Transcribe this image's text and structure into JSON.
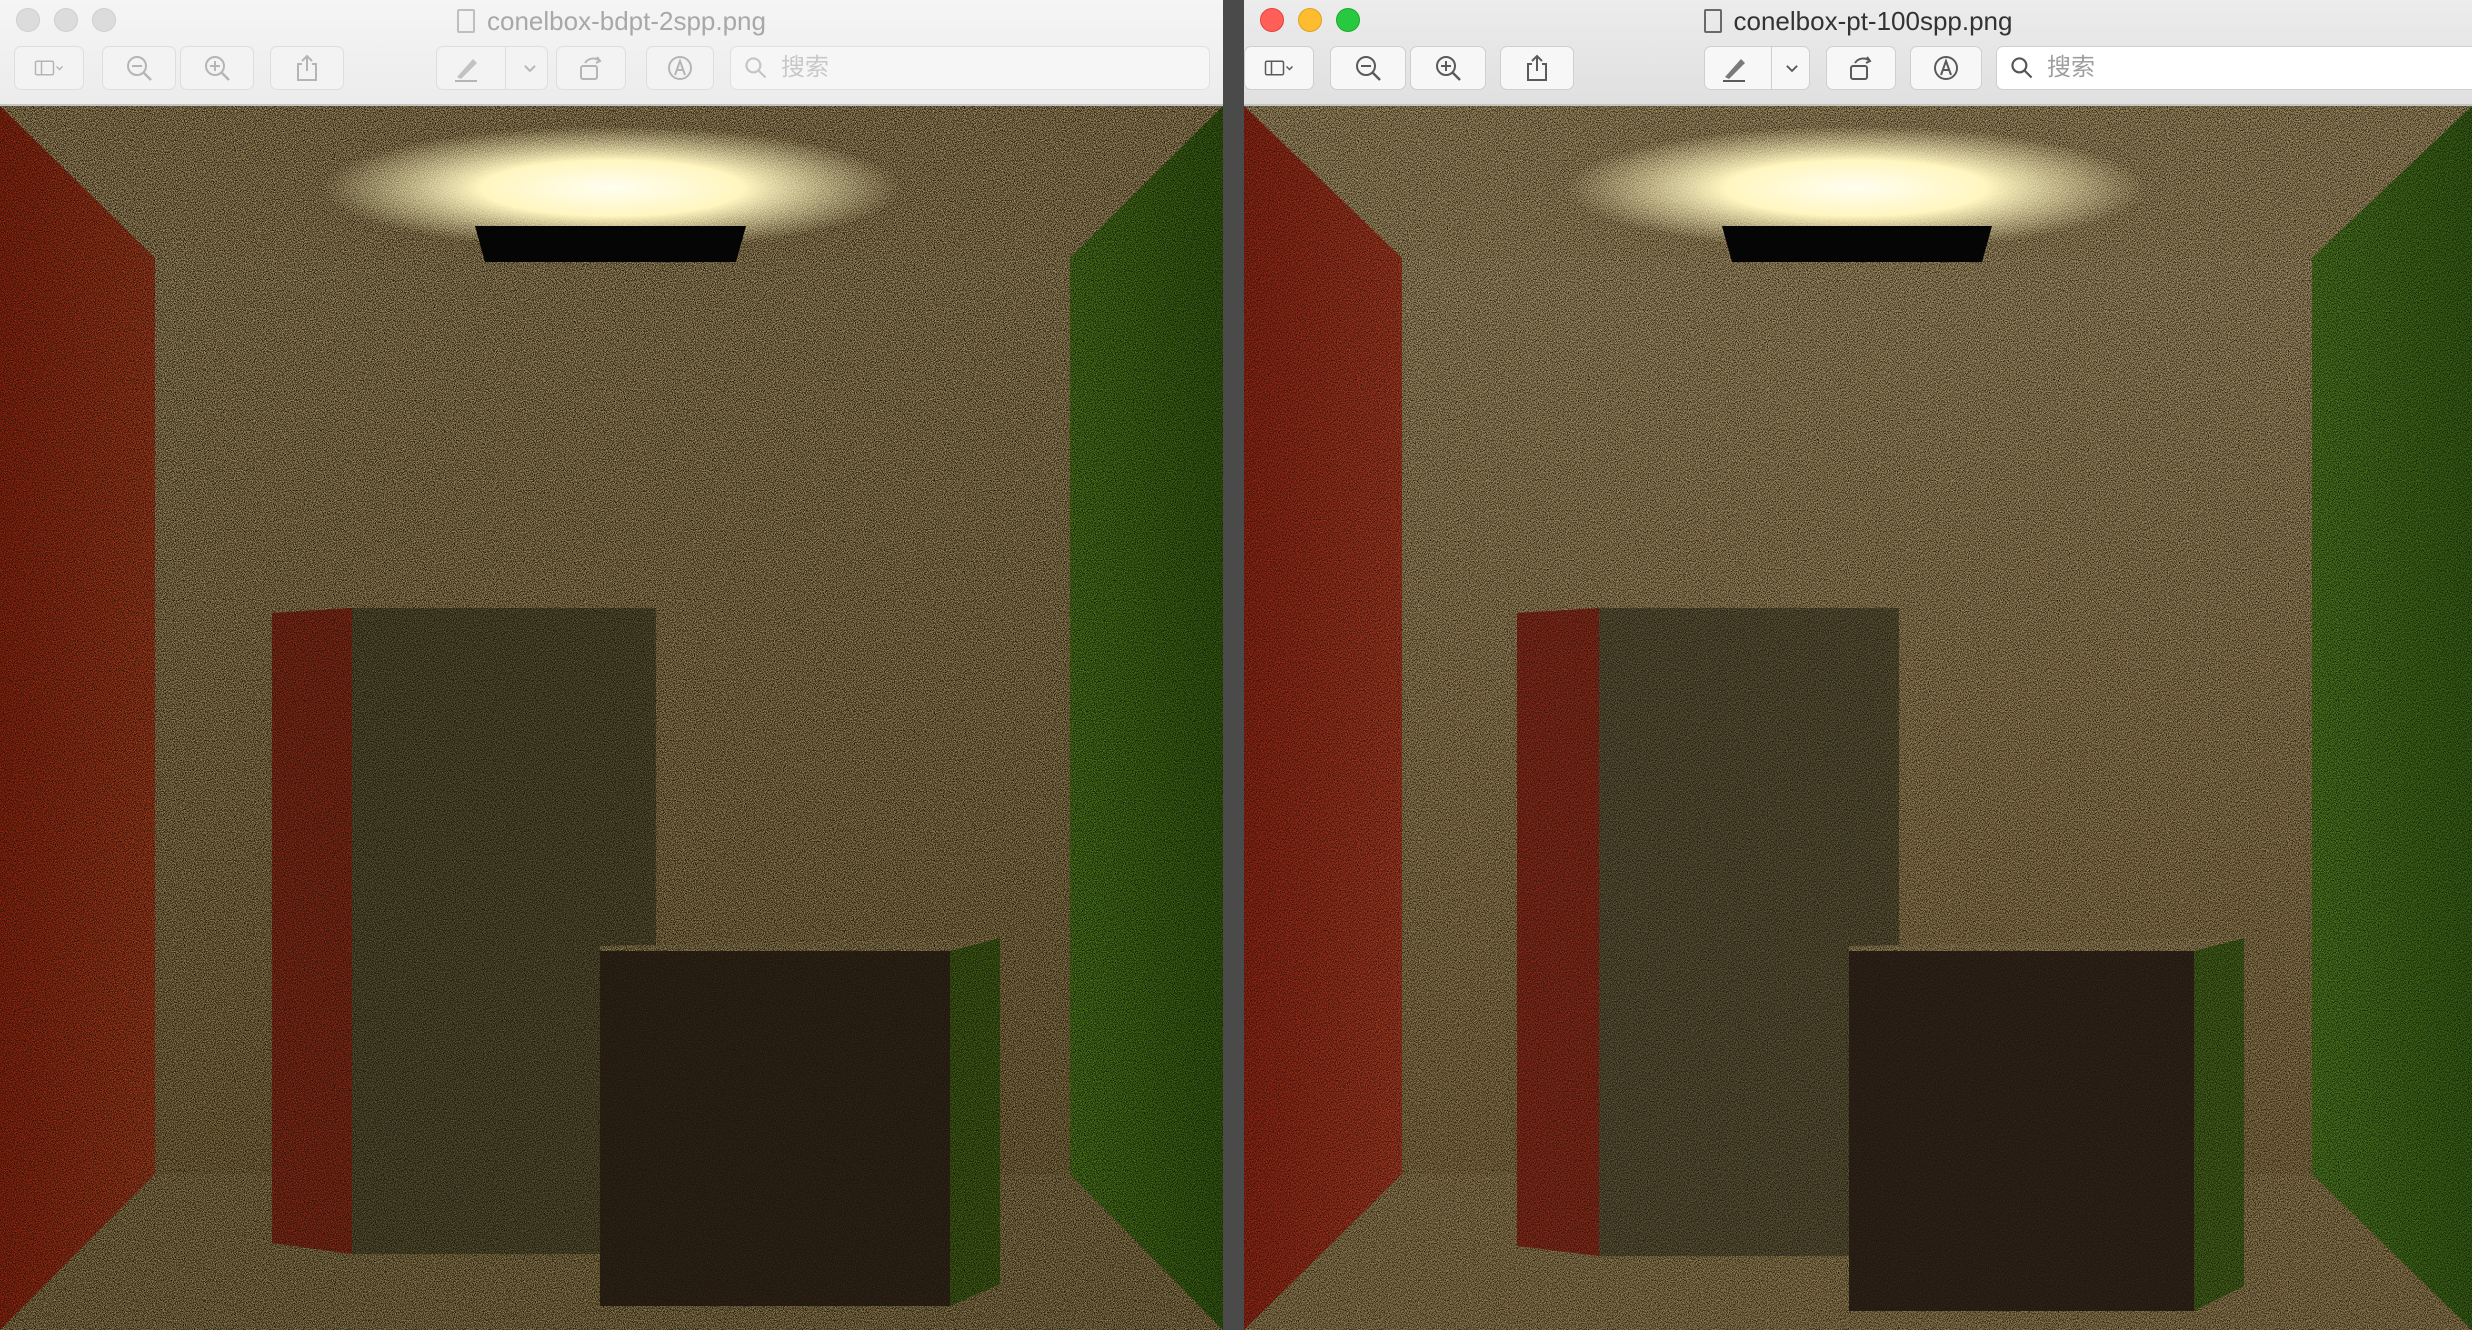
{
  "windows": [
    {
      "title": "conelbox-bdpt-2spp.png",
      "search_placeholder": "搜索",
      "active": false
    },
    {
      "title": "conelbox-pt-100spp.png",
      "search_placeholder": "搜索",
      "active": true
    }
  ],
  "colors": {
    "red_wall": "#c8321e",
    "green_wall": "#3f8a1e",
    "back_wall": "#b69e62",
    "ceiling_light": "#fffbe0",
    "light_fixture": "#050505"
  }
}
